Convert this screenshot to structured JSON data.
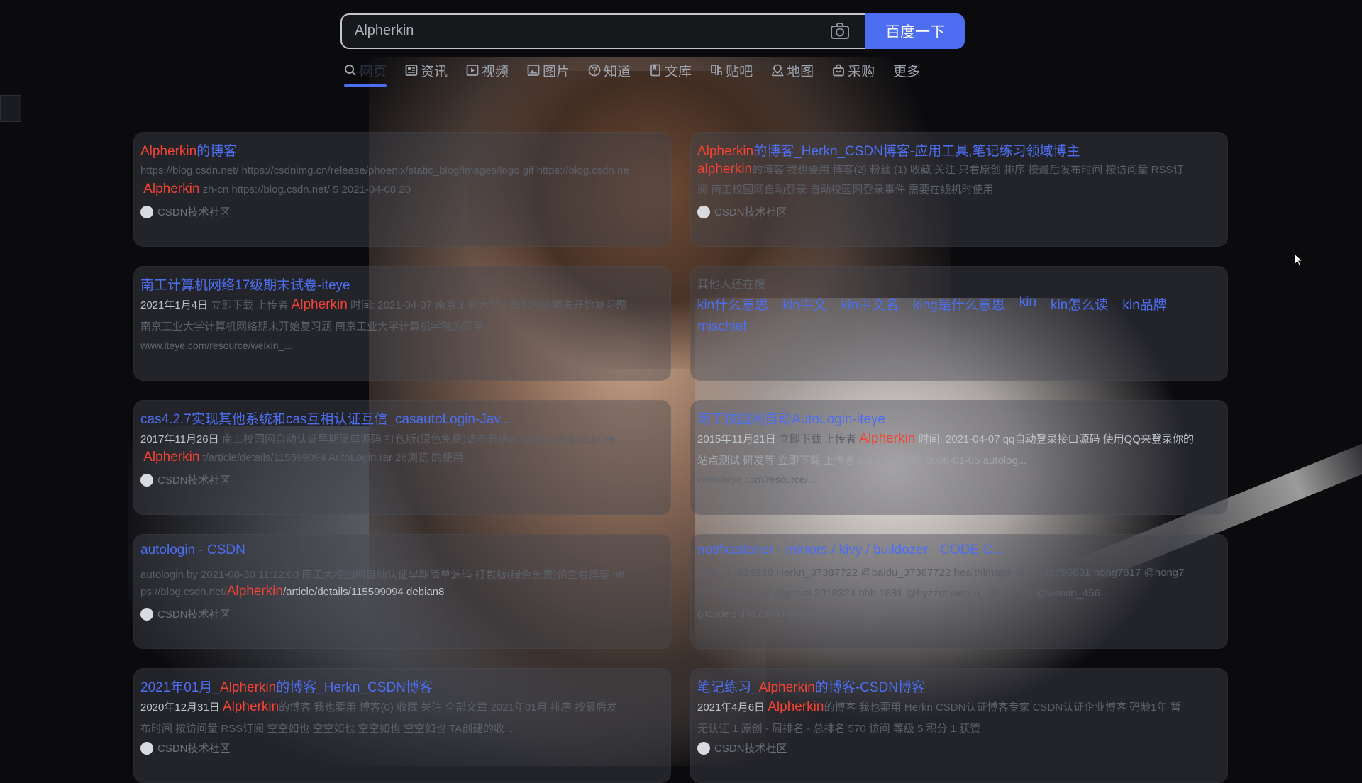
{
  "search": {
    "query": "Alpherkin",
    "button": "百度一下"
  },
  "tabs": [
    {
      "label": "网页",
      "icon": "search-icon"
    },
    {
      "label": "资讯",
      "icon": "news-icon"
    },
    {
      "label": "视频",
      "icon": "video-icon"
    },
    {
      "label": "图片",
      "icon": "image-icon"
    },
    {
      "label": "知道",
      "icon": "question-icon"
    },
    {
      "label": "文库",
      "icon": "document-icon"
    },
    {
      "label": "贴吧",
      "icon": "tieba-icon"
    },
    {
      "label": "地图",
      "icon": "map-icon"
    },
    {
      "label": "采购",
      "icon": "shopping-bag-icon"
    },
    {
      "label": "更多",
      "icon": ""
    }
  ],
  "results": {
    "r1": {
      "title_hl": "Alpherkin",
      "title_rest": "的博客",
      "line1": "https://blog.csdn.net/ https://csdnimg.cn/release/phoenix/static_blog/images/logo.gif https://blog.csdn.ne",
      "line2_hl": "Alpherkin",
      "line2": "zh-cn https://blog.csdn.net/ 5 2021-04-08 20",
      "source": "CSDN技术社区"
    },
    "r2": {
      "title_hl": "Alpherkin",
      "title_rest": "的博客_Herkn_CSDN博客-应用工具,笔记练习领域博主",
      "line1_hl": "alpherkin",
      "line1": "的博客 我也要用 博客(2) 粉丝 (1) 收藏 关注 只看原创 排序 按最后发布时间 按访问量 RSS订",
      "line2": "阅 南工校园网自动登录 自动校园网登录事件 需要在线机时使用",
      "source": "CSDN技术社区"
    },
    "r3": {
      "title": "南工计算机网络17级期末试卷-iteye",
      "date": "2021年1月4日",
      "line1": "立即下载 上传者",
      "line1_hl": "Alpherkin",
      "line1_tail": "时间: 2021-04-07 南京工业大学计算机网络期末开始复习题",
      "line2": "南京工业大学计算机网络期末开始复习题 南京工业大学计算机学院的同学...",
      "url": "www.iteye.com/resource/weixin_..."
    },
    "r4": {
      "label": "其他人还在搜",
      "keywords": [
        "kin什么意思",
        "kin中文",
        "kin中文名",
        "king是什么意思",
        "kin",
        "kin怎么读",
        "kin品牌",
        "mischief"
      ]
    },
    "r5": {
      "title": "cas4.2.7实现其他系统和cas互相认证互信_casautoLogin-Jav...",
      "date": "2017年11月26日",
      "line1": "南工校园网自动认证早期简单源码 打包版(绿色免费)请查看博客 https://blog.csdn.ne",
      "line2_hl": "Alpherkin",
      "line2": "t/article/details/115599094 AutoLogin.rar 26浏览 的使用",
      "source": "CSDN技术社区"
    },
    "r6": {
      "title": "南工校园网自动AutoLogin-iteye",
      "date": "2015年11月21日",
      "line1": "立即下载 上传者",
      "line1_hl": "Alpherkin",
      "line1_tail": "时间: 2021-04-07 qq自动登录接口源码 使用QQ来登录你的",
      "line2": "站点测试 研发等 立即下载 上传者 qoushui 时间: 2008-01-05 autolog...",
      "url": "www.iteye.com/resource/..."
    },
    "r7": {
      "title": "autologin - CSDN",
      "line1": "autologin by 2021-08-30 11:12:00 南工大校园网自动认证早期简单源码 打包版(绿色免费)请查看博客 htt",
      "line2_pre": "ps://blog.csdn.net/",
      "line2_hl": "Alpherkin",
      "line2": "/article/details/115599094 debian8",
      "source": "CSDN技术社区"
    },
    "r8": {
      "title": "notificationer · mirrors / kivy / buildozer · CODE C...",
      "line1": "@qq_34626228 Herkn_37387722 @baidu_37387722 healthimage @qq_42795831 hong7817 @hong7",
      "line2": "817 冬季日行@ @jssvzl 2018324 bhb 1881 @hyzzdf weixin_45049104 @weixin_456",
      "url": "gitcode.china.csdn.net/mirrors/kiv..."
    },
    "r9": {
      "title_pre": "2021年01月_",
      "title_hl": "Alpherkin",
      "title_rest": "的博客_Herkn_CSDN博客",
      "date": "2020年12月31日",
      "line1_hl": "Alpherkin",
      "line1": "的博客 我也要用 博客(0) 收藏 关注 全部文章 2021年01月 排序 按最后发",
      "line2": "布时间 按访问量 RSS订阅 空空如也 空空如也 空空如也 空空如也 TA创建的收...",
      "source": "CSDN技术社区"
    },
    "r10": {
      "title_pre": "笔记练习_",
      "title_hl": "Alpherkin",
      "title_rest": "的博客-CSDN博客",
      "date": "2021年4月6日",
      "line1_hl": "Alpherkin",
      "line1": "的博客 我也要用 Herkn CSDN认证博客专家 CSDN认证企业博客 码龄1年 暂",
      "line2": "无认证 1 原创 - 周排名 - 总排名 570 访问 等级 5 积分 1 获赞",
      "source": "CSDN技术社区"
    }
  },
  "colors": {
    "accent": "#4e6ef2",
    "highlight": "#f44336",
    "link": "#4e6ef2"
  }
}
